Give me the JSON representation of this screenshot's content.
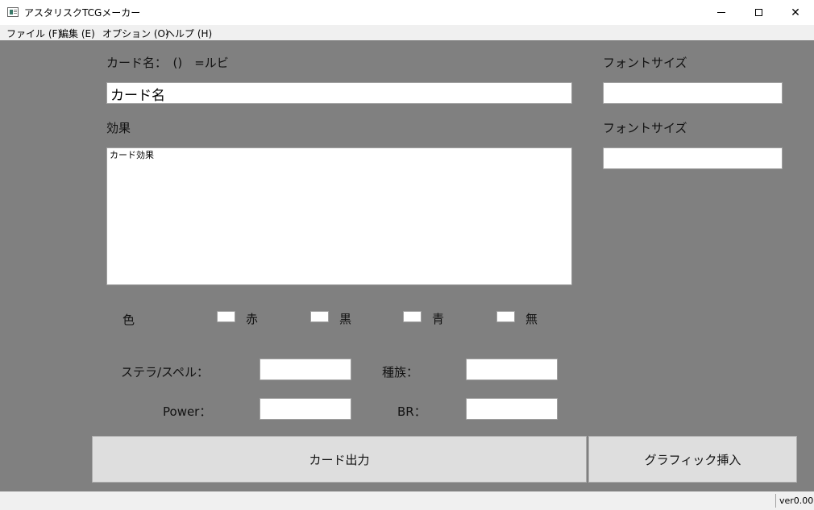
{
  "window": {
    "title": "アスタリスクTCGメーカー"
  },
  "menu": [
    {
      "label": "ファイル (F)"
    },
    {
      "label": "編集 (E)"
    },
    {
      "label": "オプション (O)"
    },
    {
      "label": "ヘルプ (H)"
    }
  ],
  "form": {
    "card_name_label": "カード名：　()　=ルビ",
    "card_name_value": "カード名",
    "name_font_size_label": "フォントサイズ",
    "name_font_size_value": "",
    "effect_label": "効果",
    "effect_value": "カード効果",
    "effect_font_size_label": "フォントサイズ",
    "effect_font_size_value": "",
    "color_label": "色",
    "colors": [
      {
        "label": "赤",
        "checked": false
      },
      {
        "label": "黒",
        "checked": false
      },
      {
        "label": "青",
        "checked": false
      },
      {
        "label": "無",
        "checked": false
      }
    ],
    "stella_spell_label": "ステラ/スペル：",
    "stella_spell_value": "",
    "race_label": "種族：",
    "race_value": "",
    "power_label": "Power：",
    "power_value": "",
    "br_label": "BR：",
    "br_value": ""
  },
  "buttons": {
    "output": "カード出力",
    "insert_graphic": "グラフィック挿入"
  },
  "status": {
    "version": "ver0.00"
  },
  "colors": {
    "background": "#808080",
    "titlebar": "#ffffff",
    "menubar": "#f0f0f0",
    "button": "#dedede"
  }
}
